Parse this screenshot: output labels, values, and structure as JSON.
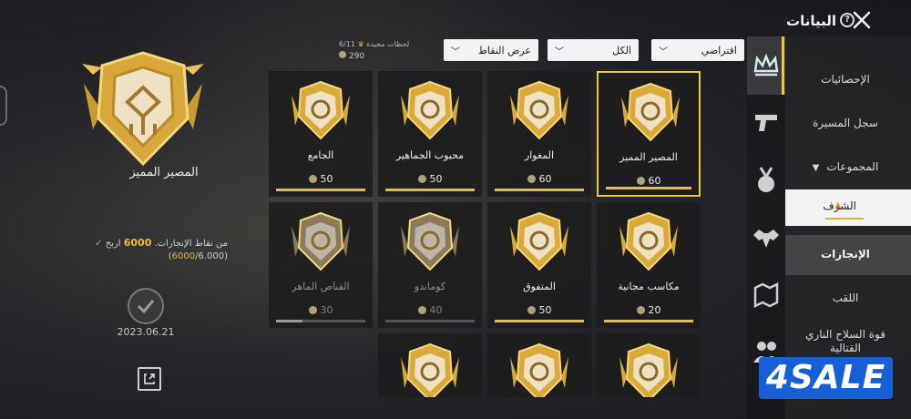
{
  "header": {
    "title": "البيانات",
    "help_icon": "question-mark-icon",
    "close_icon": "close-x-icon"
  },
  "feature": {
    "name": "المصير المميز",
    "progress_prefix": "اربح",
    "progress_value": "6000",
    "progress_suffix": "من نقاط الإنجازات.",
    "progress_current": "6000",
    "progress_total": "/6.000)",
    "progress_open": "(",
    "date": "2023.06.21"
  },
  "collection": {
    "label": "لحظات مجيدة",
    "count": "6/11",
    "points": "290"
  },
  "filters": {
    "points_view": "عرض النقاط",
    "all": "الكل",
    "default": "افتراضي"
  },
  "cards": [
    {
      "title": "المصير المميز",
      "points": "60",
      "progress": 1.0,
      "locked": false,
      "selected": true
    },
    {
      "title": "المغوار",
      "points": "60",
      "progress": 1.0,
      "locked": false,
      "selected": false
    },
    {
      "title": "محبوب الجماهير",
      "points": "50",
      "progress": 1.0,
      "locked": false,
      "selected": false
    },
    {
      "title": "الجامع",
      "points": "50",
      "progress": 1.0,
      "locked": false,
      "selected": false
    },
    {
      "title": "مكاسب مجانية",
      "points": "20",
      "progress": 1.0,
      "locked": false,
      "selected": false
    },
    {
      "title": "المتفوق",
      "points": "50",
      "progress": 1.0,
      "locked": false,
      "selected": false
    },
    {
      "title": "كوماندو",
      "points": "40",
      "progress": 0.0,
      "locked": true,
      "selected": false
    },
    {
      "title": "القناص الماهر",
      "points": "30",
      "progress": 0.3,
      "locked": true,
      "selected": false
    },
    {
      "title": "",
      "points": "",
      "progress": 0,
      "locked": false,
      "selected": false
    },
    {
      "title": "",
      "points": "",
      "progress": 0,
      "locked": false,
      "selected": false
    },
    {
      "title": "",
      "points": "",
      "progress": 0,
      "locked": false,
      "selected": false
    }
  ],
  "menu": {
    "stats": "الإحصائيات",
    "career": "سجل المسيرة",
    "groups": "المجموعات",
    "honor": "الشرف",
    "achievements": "الإنجازات",
    "title": "اللقب",
    "firepower": "قوة السلاح الناري القتالية"
  },
  "watermark": "4SALE"
}
